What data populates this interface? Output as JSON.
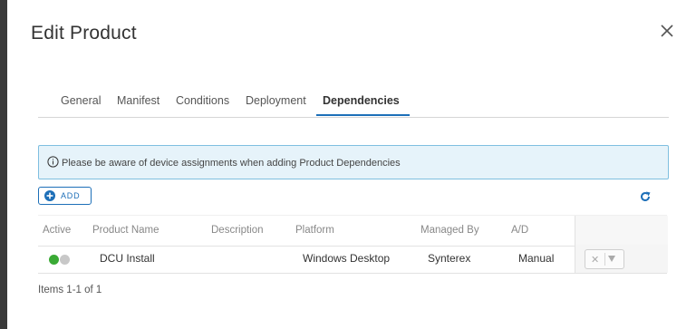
{
  "dialog": {
    "title": "Edit Product",
    "close_icon": "close-icon"
  },
  "tabs": [
    {
      "label": "General",
      "active": false
    },
    {
      "label": "Manifest",
      "active": false
    },
    {
      "label": "Conditions",
      "active": false
    },
    {
      "label": "Deployment",
      "active": false
    },
    {
      "label": "Dependencies",
      "active": true
    }
  ],
  "notice": {
    "icon": "info-icon",
    "text": "Please be aware of device assignments when adding Product Dependencies"
  },
  "toolbar": {
    "add_label": "ADD",
    "add_icon": "plus-circle-icon",
    "refresh_icon": "refresh-icon"
  },
  "grid": {
    "columns": [
      "Active",
      "Product Name",
      "Description",
      "Platform",
      "Managed By",
      "A/D"
    ],
    "rows": [
      {
        "active": true,
        "product_name": "DCU Install",
        "description": "",
        "platform": "Windows Desktop",
        "managed_by": "Synterex",
        "ad": "Manual"
      }
    ],
    "pager_text": "Items 1-1 of 1"
  },
  "colors": {
    "accent": "#1d6fb8",
    "toggle_on": "#3aaa35",
    "toggle_off": "#c8c8c8",
    "notice_bg": "#e6f3fa"
  }
}
